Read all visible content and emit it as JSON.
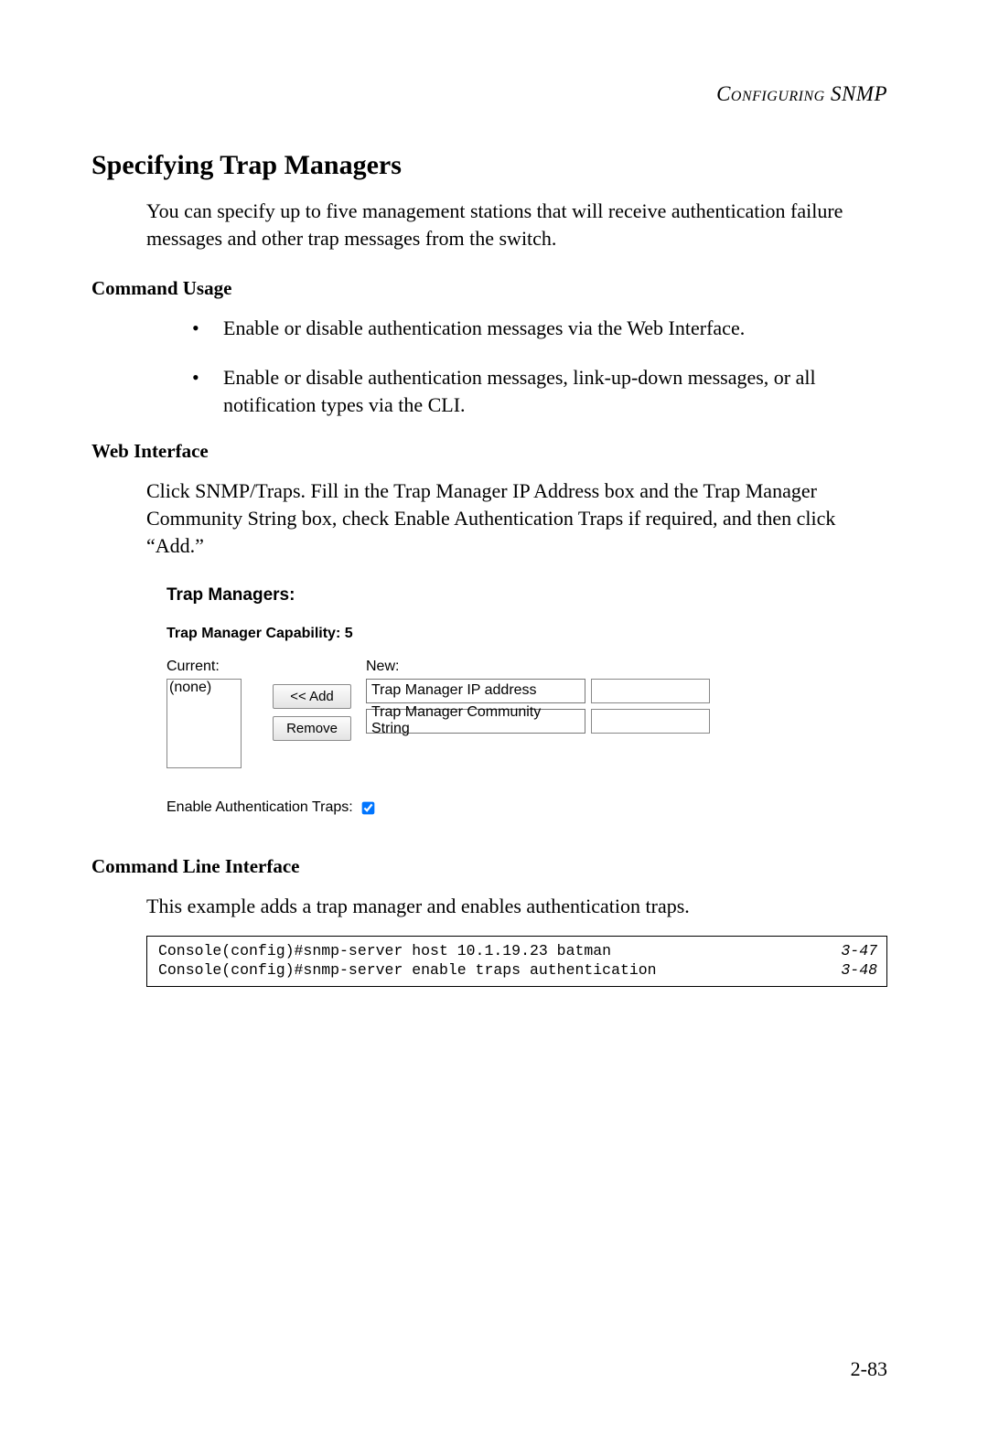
{
  "header": {
    "running": "Configuring SNMP"
  },
  "section": {
    "title": "Specifying Trap Managers",
    "intro": "You can specify up to five management stations that will receive authentication failure messages and other trap messages from the switch."
  },
  "command_usage": {
    "heading": "Command Usage",
    "items": [
      "Enable or disable authentication messages via the Web Interface.",
      "Enable or disable authentication messages, link-up-down messages, or all notification types via the CLI."
    ]
  },
  "web_interface": {
    "heading": "Web Interface",
    "body": "Click SNMP/Traps. Fill in the Trap Manager IP Address box and the Trap Manager Community String box, check Enable Authentication Traps if required, and then click “Add.”"
  },
  "ui": {
    "title": "Trap Managers:",
    "capability": "Trap Manager Capability: 5",
    "current_label": "Current:",
    "current_list": "(none)",
    "new_label": "New:",
    "add_btn": "<< Add",
    "remove_btn": "Remove",
    "ip_label": "Trap Manager IP address",
    "community_label": "Trap Manager Community String",
    "auth_label": "Enable Authentication Traps:",
    "auth_checked": true
  },
  "cli": {
    "heading": "Command Line Interface",
    "intro": "This example adds a trap manager and enables authentication traps.",
    "lines": [
      {
        "cmd": "Console(config)#snmp-server host 10.1.19.23 batman",
        "ref": "3-47"
      },
      {
        "cmd": "Console(config)#snmp-server enable traps authentication",
        "ref": "3-48"
      }
    ]
  },
  "page_number": "2-83"
}
